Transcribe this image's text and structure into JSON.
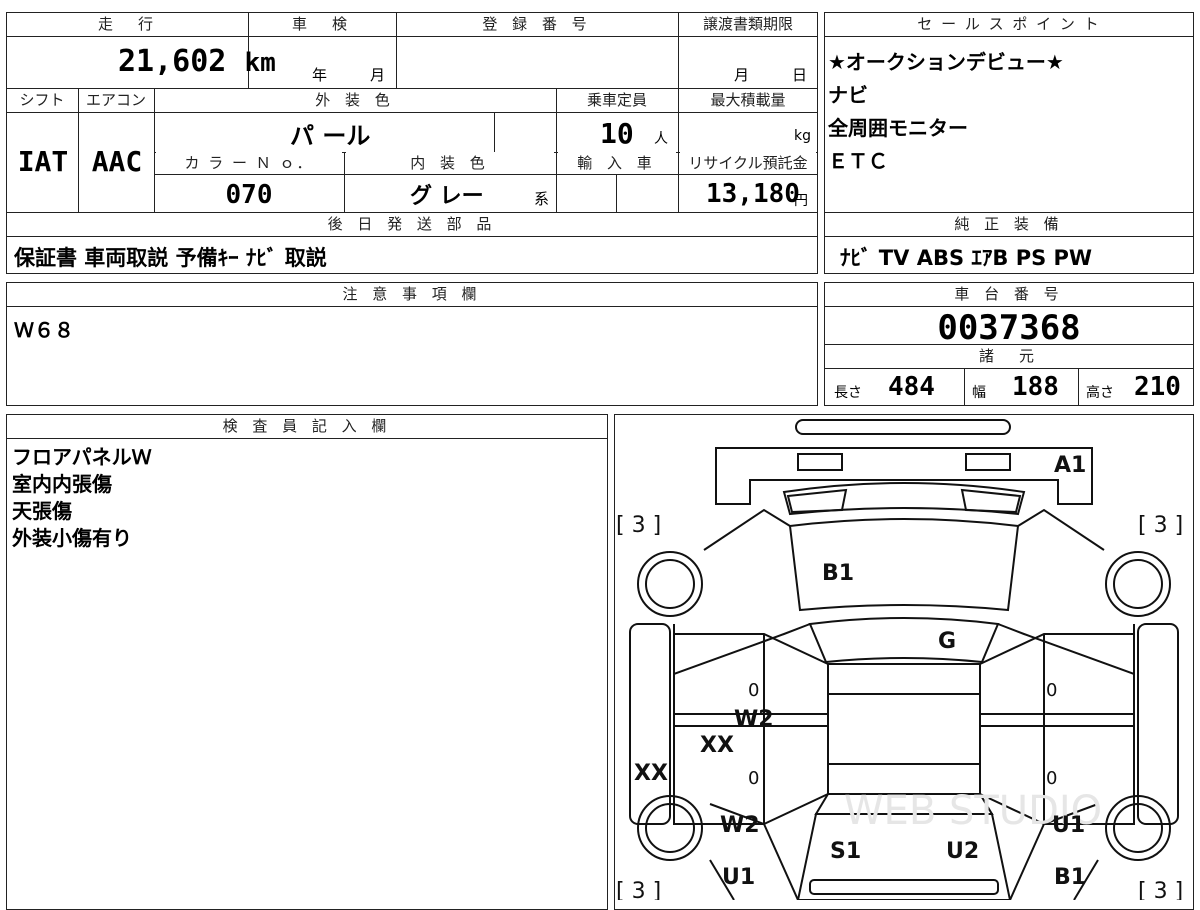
{
  "top": {
    "mileage_header": "走　行",
    "mileage": "21,602",
    "mileage_unit": "km",
    "inspection_header": "車　検",
    "inspection_year_label": "年",
    "inspection_month_label": "月",
    "registration_header": "登 録 番 号",
    "transfer_header": "譲渡書類期限",
    "transfer_month_label": "月",
    "transfer_day_label": "日",
    "shift_header": "シフト",
    "shift": "IAT",
    "ac_header": "エアコン",
    "ac": "AAC",
    "exterior_color_header": "外 装 色",
    "exterior_color": "パ ール",
    "capacity_header": "乗車定員",
    "capacity": "10",
    "capacity_unit": "人",
    "max_load_header": "最大積載量",
    "max_load_unit": "kg",
    "color_no_header": "カ ラ ー Ｎ ｏ．",
    "color_no": "070",
    "interior_color_header": "内 装 色",
    "interior_color": "グ レー",
    "interior_suffix": "系",
    "import_header": "輸 入 車",
    "recycle_header": "リサイクル預託金",
    "recycle_fee": "13,180",
    "recycle_unit": "円",
    "later_parts_header": "後 日 発 送 部 品",
    "later_parts": "保証書  車両取説  予備ｷｰ  ﾅﾋﾞ 取説"
  },
  "sales_points": {
    "header": "セ ー ル ス ポ イ ン ト",
    "lines": [
      "★オークションデビュー★",
      "ナビ",
      "全周囲モニター",
      "ＥＴＣ"
    ]
  },
  "factory_equipment": {
    "header": "純 正 装 備",
    "value": "ﾅﾋﾞ   TV   ABS  ｴｱB  PS  PW"
  },
  "notes": {
    "header": "注 意 事 項 欄",
    "value": "Ｗ６８"
  },
  "chassis": {
    "header": "車 台 番 号",
    "number": "0037368"
  },
  "specs": {
    "header": "諸　元",
    "length_label": "長さ",
    "length": "484",
    "width_label": "幅",
    "width": "188",
    "height_label": "高さ",
    "height": "210"
  },
  "inspector": {
    "header": "検 査 員 記 入 欄",
    "lines": [
      "フロアパネルＷ",
      "室内内張傷",
      "天張傷",
      "外装小傷有り"
    ]
  },
  "diagram": {
    "marks": {
      "A1": "A1",
      "B1_hood": "B1",
      "G": "G",
      "W2_left": "W2",
      "XX_left_door": "XX",
      "XX_left_side": "XX",
      "W2_rear_left": "W2",
      "U1_rear_left": "U1",
      "S1": "S1",
      "U2": "U2",
      "U1_rear_right": "U1",
      "B1_rear_right": "B1",
      "zero_1": "0",
      "zero_2": "0",
      "zero_3": "0",
      "zero_4": "0"
    },
    "tire_tread": {
      "front_left": "[ 3 ]",
      "front_right": "[ 3 ]",
      "rear_left": "[ 3 ]",
      "rear_right": "[ 3 ]"
    },
    "watermark": "WEB STUDIO"
  }
}
